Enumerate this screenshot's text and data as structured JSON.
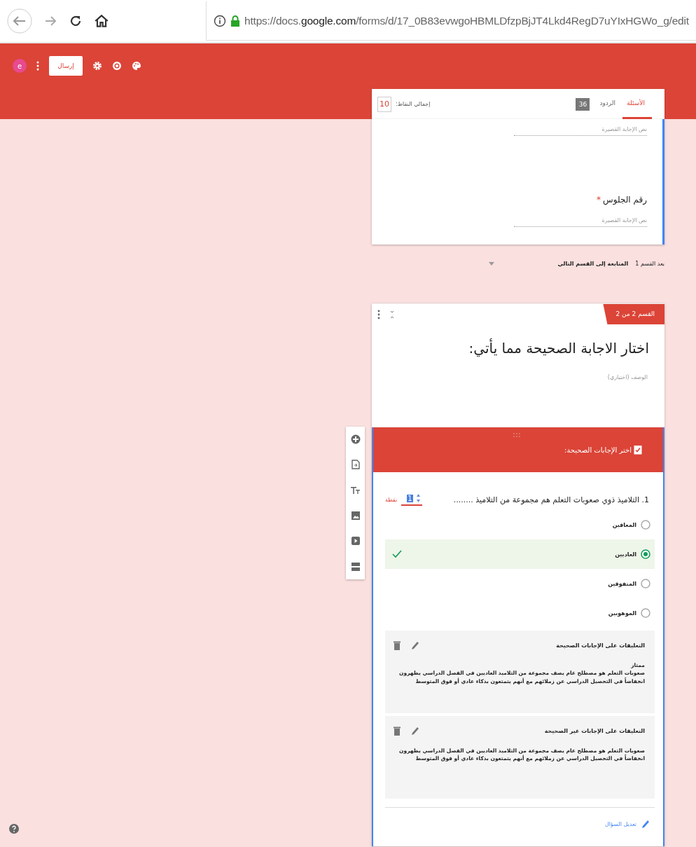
{
  "browser": {
    "url": "https://docs.**google.com**/forms/d/17_0B83evwgoHBMLDfzpBjJT4Lkd4RegD7uYIxHGWo_g/edit"
  },
  "toolbar": {
    "avatar": "e",
    "send_label": "إرسال"
  },
  "tabs": [
    {
      "label": "الأسئلة",
      "selected": true
    },
    {
      "label": "الردود",
      "selected": false,
      "badge": "36"
    }
  ],
  "total_points": {
    "label": "إجمالي النقاط:",
    "value": "10"
  },
  "section_1": {
    "questions": [
      {
        "placeholder": "نص الإجابة القصيرة"
      },
      {
        "title": "رقم الجلوس",
        "required_mark": "*",
        "placeholder": "نص الإجابة القصيرة"
      }
    ]
  },
  "after_section": {
    "label": "بعد القسم 1",
    "value": "المتابعة إلى القسم التالي"
  },
  "section_2": {
    "badge": "القسم 2 من 2",
    "title": "اختار الاجابة الصحيحة مما يأتي:",
    "description_placeholder": "الوصف (اختياري)"
  },
  "answer_key": {
    "header": "اختر الإجابات الصحيحة:",
    "question": "1. التلاميذ ذوي صعوبات التعلم هم مجموعة من التلاميذ ........",
    "points": "1",
    "points_label": "نقطة",
    "options": [
      {
        "label": "المعاقين",
        "selected": false
      },
      {
        "label": "العاديين",
        "selected": true
      },
      {
        "label": "المتفوقين",
        "selected": false
      },
      {
        "label": "الموهوبين",
        "selected": false
      }
    ],
    "feedback": [
      {
        "title": "التعليقات على الإجابات الصحيحة",
        "paragraphs": [
          "ممتاز",
          "صعوبات التعلم هو مصطلح عام يصف مجموعة من التلاميذ العاديين في الفصل الدراسي يظهرون انخفاضاً في التحصيل الدراسي عن زملائهم مع أنهم يتمتعون بذكاء عادي أو فوق المتوسط"
        ]
      },
      {
        "title": "التعليقات على الإجابات غير الصحيحة",
        "paragraphs": [
          "صعوبات التعلم هو مصطلح عام يصف مجموعة من التلاميذ العاديين في الفصل الدراسي يظهرون انخفاضاً في التحصيل الدراسي عن زملائهم مع أنهم يتمتعون بذكاء عادي أو فوق المتوسط"
        ]
      }
    ],
    "edit_label": "تعديل السؤال"
  }
}
